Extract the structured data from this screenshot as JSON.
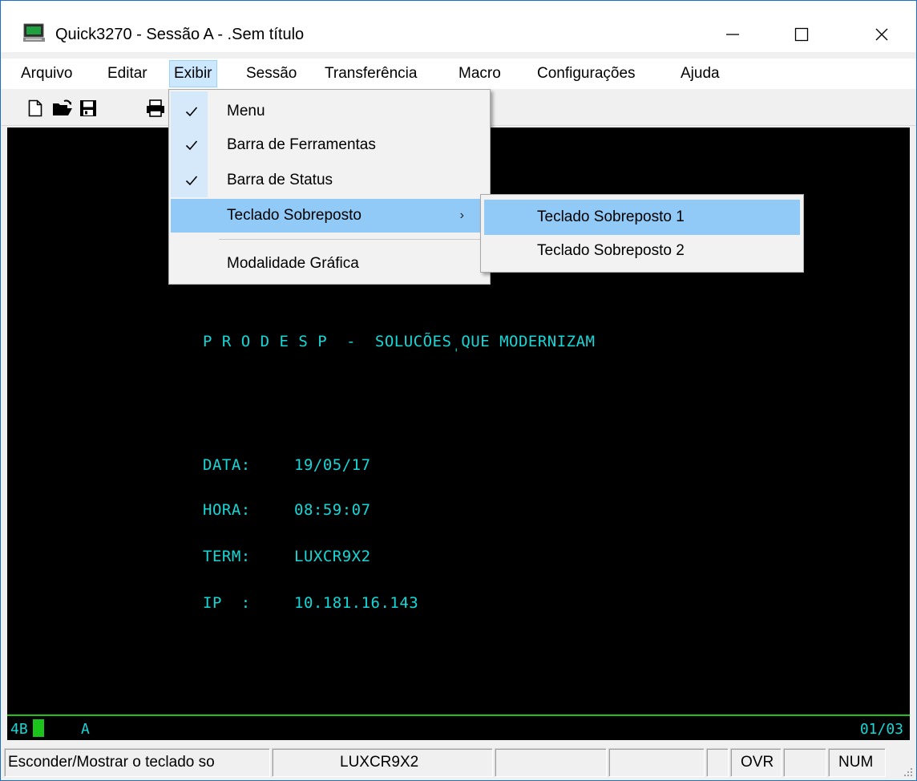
{
  "window": {
    "title": "Quick3270 - Sessão A - .Sem título",
    "controls": {
      "minimize": "—",
      "maximize": "☐",
      "close": "✕"
    }
  },
  "menubar": {
    "items": [
      {
        "label": "Arquivo"
      },
      {
        "label": "Editar"
      },
      {
        "label": "Exibir",
        "active": true
      },
      {
        "label": "Sessão"
      },
      {
        "label": "Transferência"
      },
      {
        "label": "Macro"
      },
      {
        "label": "Configurações"
      },
      {
        "label": "Ajuda"
      }
    ]
  },
  "toolbar": {
    "icons": [
      "new-document-icon",
      "open-folder-icon",
      "save-disk-icon",
      "print-icon"
    ]
  },
  "exibir_menu": {
    "items": [
      {
        "label": "Menu",
        "checked": true
      },
      {
        "label": "Barra de Ferramentas",
        "checked": true
      },
      {
        "label": "Barra de Status",
        "checked": true
      },
      {
        "label": "Teclado Sobreposto",
        "submenu": true,
        "highlighted": true
      },
      {
        "label": "Modalidade Gráfica"
      }
    ],
    "submenu_arrow": "›"
  },
  "teclado_submenu": {
    "items": [
      {
        "label": "Teclado Sobreposto 1",
        "highlighted": true
      },
      {
        "label": "Teclado Sobreposto 2"
      }
    ]
  },
  "terminal": {
    "banner": "P R O D E S P  -  SOLUCÕES QUE MODERNIZAM",
    "fields": [
      {
        "label": "DATA:",
        "value": "19/05/17"
      },
      {
        "label": "HORA:",
        "value": "08:59:07"
      },
      {
        "label": "TERM:",
        "value": "LUXCR9X2"
      },
      {
        "label": "IP  :",
        "value": "10.181.16.143"
      }
    ],
    "colors": {
      "background": "#000000",
      "text": "#16d7d7",
      "oia_line": "#1bc41b"
    }
  },
  "oia": {
    "left": "4B",
    "mode": "A",
    "cursor_pos": "01/03"
  },
  "statusbar": {
    "message": "Esconder/Mostrar o teclado so",
    "terminal": "LUXCR9X2",
    "ovr": "OVR",
    "num": "NUM"
  }
}
